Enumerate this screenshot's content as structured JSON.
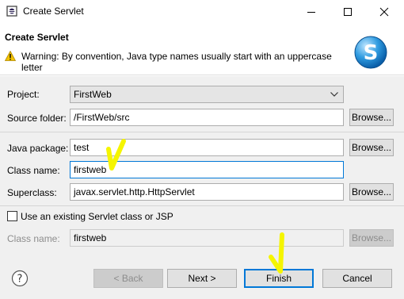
{
  "window": {
    "title": "Create Servlet"
  },
  "banner": {
    "title": "Create Servlet",
    "message": "Warning: By convention, Java type names usually start with an uppercase letter",
    "logo_icon": "servlet-s-logo"
  },
  "form": {
    "project": {
      "label": "Project:",
      "value": "FirstWeb"
    },
    "source_folder": {
      "label": "Source folder:",
      "value": "/FirstWeb/src",
      "browse_label": "Browse..."
    },
    "java_package": {
      "label": "Java package:",
      "value": "test",
      "browse_label": "Browse..."
    },
    "class_name": {
      "label": "Class name:",
      "value": "firstweb"
    },
    "superclass": {
      "label": "Superclass:",
      "value": "javax.servlet.http.HttpServlet",
      "browse_label": "Browse..."
    },
    "use_existing": {
      "label": "Use an existing Servlet class or JSP",
      "checked": false
    },
    "existing_class": {
      "label": "Class name:",
      "value": "firstweb",
      "browse_label": "Browse..."
    }
  },
  "footer": {
    "back_label": "< Back",
    "next_label": "Next >",
    "finish_label": "Finish",
    "cancel_label": "Cancel"
  },
  "colors": {
    "accent": "#0078d7",
    "annotation": "#f5f500",
    "warning": "#f2c200"
  }
}
